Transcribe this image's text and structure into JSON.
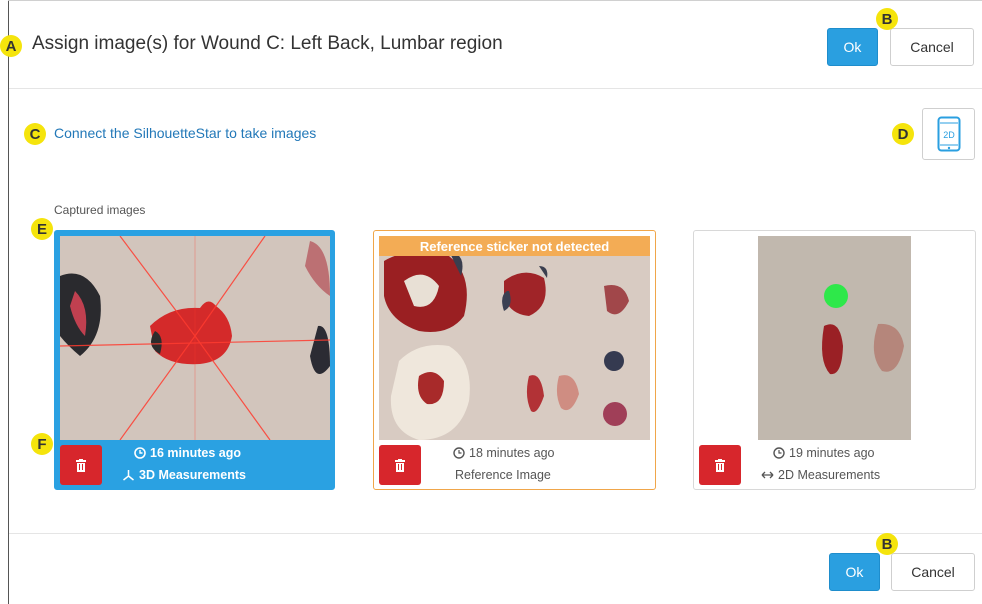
{
  "dialog": {
    "title": "Assign image(s) for Wound C: Left Back, Lumbar region",
    "ok_label": "Ok",
    "cancel_label": "Cancel",
    "connect_text": "Connect the SilhouetteStar to take images",
    "mode_label": "2D",
    "captured_label": "Captured images"
  },
  "annotations": {
    "a": "A",
    "b": "B",
    "c": "C",
    "d": "D",
    "e": "E",
    "f": "F"
  },
  "images": [
    {
      "time": "16 minutes ago",
      "type": "3D Measurements",
      "banner": "",
      "icon": "3d-axis-icon"
    },
    {
      "time": "18 minutes ago",
      "type": "Reference Image",
      "banner": "Reference sticker not detected",
      "icon": ""
    },
    {
      "time": "19 minutes ago",
      "type": "2D Measurements",
      "banner": "",
      "icon": "horizontal-arrows-icon"
    }
  ],
  "colors": {
    "accent": "#2a9fe0",
    "delete": "#d7262c",
    "warning": "#f3ac55",
    "badge": "#f5e40c"
  }
}
